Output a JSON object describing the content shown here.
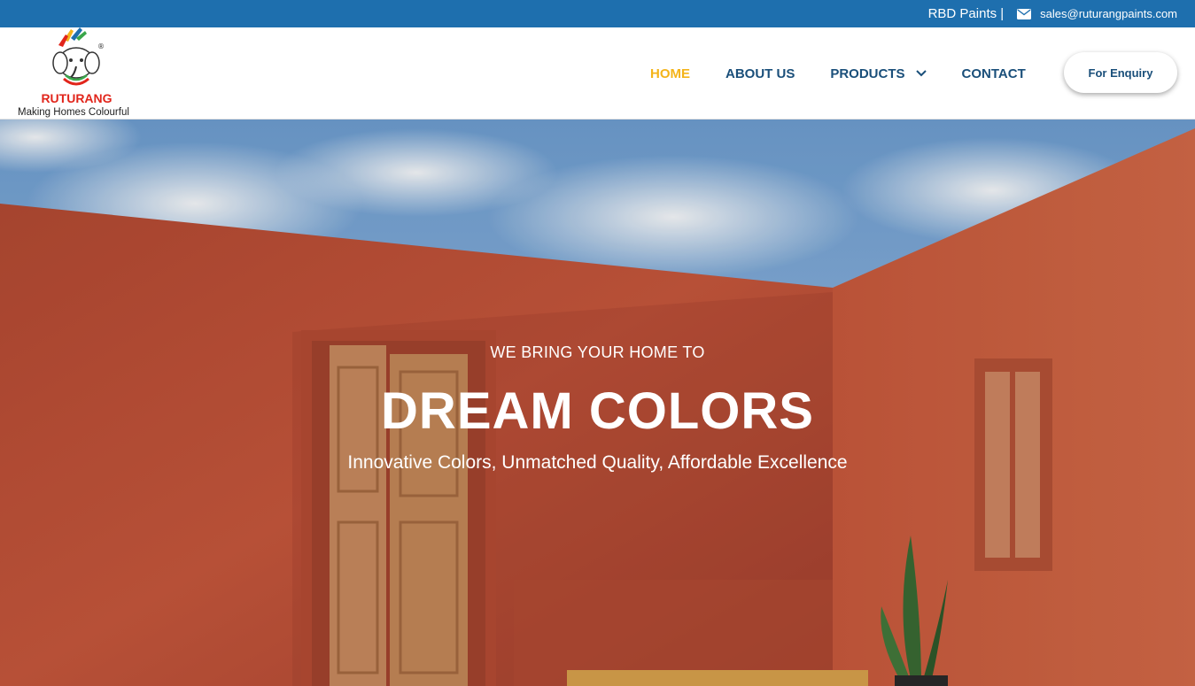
{
  "topbar": {
    "brand": "RBD Paints |",
    "email": "sales@ruturangpaints.com",
    "email_icon": "envelope-icon",
    "background": "#1e6fae"
  },
  "logo": {
    "name": "RUTURANG",
    "tagline": "Making Homes Colourful",
    "registered": "®"
  },
  "nav": {
    "items": [
      {
        "label": "HOME",
        "active": true
      },
      {
        "label": "ABOUT US",
        "active": false
      },
      {
        "label": "PRODUCTS",
        "active": false,
        "icon": "chevron-down-icon"
      },
      {
        "label": "CONTACT",
        "active": false
      }
    ],
    "enquiry_label": "For Enquiry",
    "active_color": "#f4b41a",
    "color": "#1a4f7a"
  },
  "hero": {
    "kicker": "WE BRING YOUR HOME TO",
    "title": "DREAM COLORS",
    "subtitle": "Innovative Colors, Unmatched Quality, Affordable Excellence",
    "wall_color": "#c2533a"
  }
}
